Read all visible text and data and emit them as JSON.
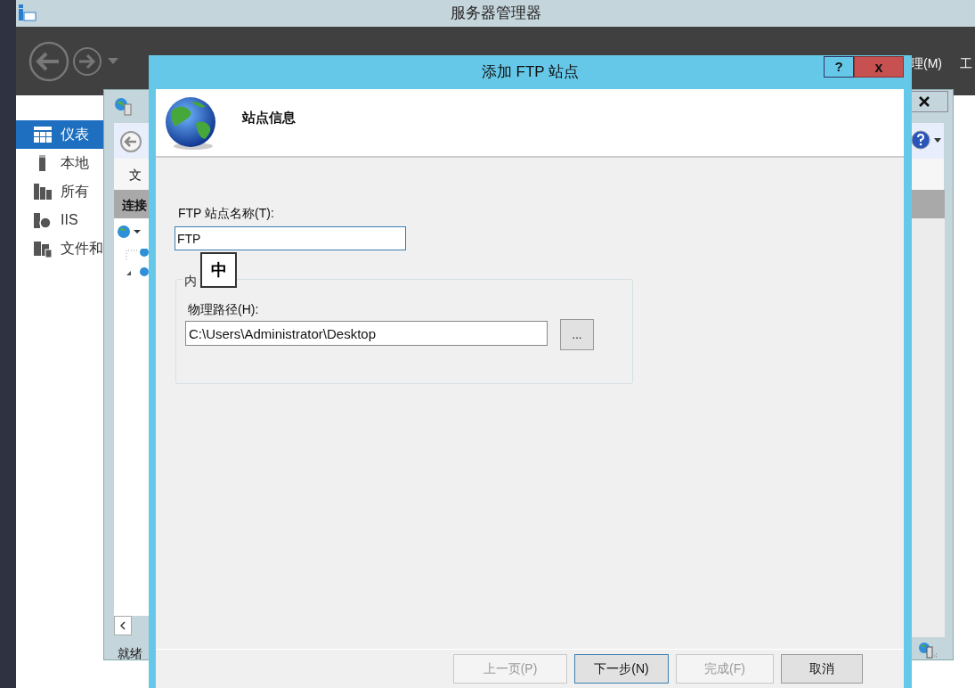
{
  "server_manager": {
    "title": "服务器管理器",
    "header_menu": [
      "理(M)",
      "工"
    ],
    "sidebar": [
      {
        "label": "仪表",
        "kind": "dashboard",
        "selected": true
      },
      {
        "label": "本地",
        "kind": "server",
        "selected": false
      },
      {
        "label": "所有",
        "kind": "servers",
        "selected": false
      },
      {
        "label": "IIS",
        "kind": "iis",
        "selected": false
      },
      {
        "label": "文件和",
        "kind": "files",
        "selected": false
      }
    ]
  },
  "iis_window": {
    "menu": "文",
    "connections_header": "连接",
    "status": "就绪"
  },
  "dialog": {
    "title": "添加 FTP 站点",
    "help_button": "?",
    "close_button": "x",
    "header": "站点信息",
    "site_name": {
      "label": "FTP 站点名称(T):",
      "value": "FTP"
    },
    "ime_indicator": "中",
    "content_group": {
      "legend": "内",
      "path_label": "物理路径(H):",
      "path_value": "C:\\Users\\Administrator\\Desktop",
      "browse_button": "..."
    },
    "buttons": [
      {
        "label": "上一页(P)",
        "disabled": true,
        "default": false
      },
      {
        "label": "下一步(N)",
        "disabled": false,
        "default": true
      },
      {
        "label": "完成(F)",
        "disabled": true,
        "default": false
      },
      {
        "label": "取消",
        "disabled": false,
        "default": false
      }
    ]
  }
}
